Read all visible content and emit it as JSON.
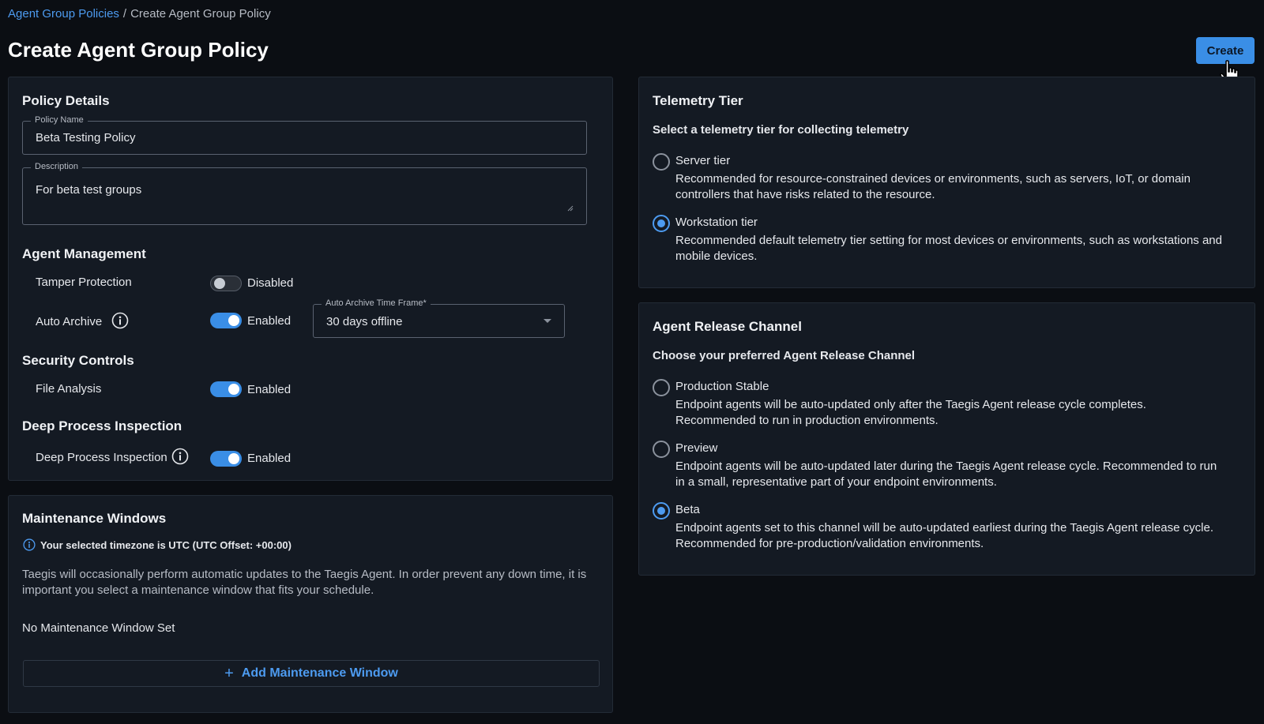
{
  "breadcrumb": {
    "parent": "Agent Group Policies",
    "separator": "/",
    "current": "Create Agent Group Policy"
  },
  "header": {
    "title": "Create Agent Group Policy",
    "create_label": "Create"
  },
  "policy_details": {
    "title": "Policy Details",
    "name_label": "Policy Name",
    "name_value": "Beta Testing Policy",
    "description_label": "Description",
    "description_value": "For beta test groups"
  },
  "agent_management": {
    "title": "Agent Management",
    "tamper_label": "Tamper Protection",
    "tamper_state": "Disabled",
    "archive_label": "Auto Archive",
    "archive_state": "Enabled",
    "timeframe_label": "Auto Archive Time Frame*",
    "timeframe_value": "30 days offline"
  },
  "security_controls": {
    "title": "Security Controls",
    "file_label": "File Analysis",
    "file_state": "Enabled"
  },
  "deep_process": {
    "title": "Deep Process Inspection",
    "label": "Deep Process Inspection",
    "state": "Enabled"
  },
  "maintenance": {
    "title": "Maintenance Windows",
    "timezone_note": "Your selected timezone is UTC (UTC Offset: +00:00)",
    "description": "Taegis will occasionally perform automatic updates to the Taegis Agent. In order prevent any down time, it is important you select a maintenance window that fits your schedule.",
    "none_text": "No Maintenance Window Set",
    "add_label": "Add Maintenance Window"
  },
  "telemetry": {
    "title": "Telemetry Tier",
    "subtitle": "Select a telemetry tier for collecting telemetry",
    "options": [
      {
        "label": "Server tier",
        "description": "Recommended for resource-constrained devices or environments, such as servers, IoT, or domain controllers that have risks related to the resource.",
        "selected": false
      },
      {
        "label": "Workstation tier",
        "description": "Recommended default telemetry tier setting for most devices or environments, such as workstations and mobile devices.",
        "selected": true
      }
    ]
  },
  "release_channel": {
    "title": "Agent Release Channel",
    "subtitle": "Choose your preferred Agent Release Channel",
    "options": [
      {
        "label": "Production Stable",
        "description": "Endpoint agents will be auto-updated only after the Taegis Agent release cycle completes. Recommended to run in production environments.",
        "selected": false
      },
      {
        "label": "Preview",
        "description": "Endpoint agents will be auto-updated later during the Taegis Agent release cycle. Recommended to run in a small, representative part of your endpoint environments.",
        "selected": false
      },
      {
        "label": "Beta",
        "description": "Endpoint agents set to this channel will be auto-updated earliest during the Taegis Agent release cycle. Recommended for pre-production/validation environments.",
        "selected": true
      }
    ]
  },
  "colors": {
    "accent": "#3a8ee6",
    "link": "#4d9bf0",
    "background": "#0b0e13",
    "panel": "#141a23"
  }
}
